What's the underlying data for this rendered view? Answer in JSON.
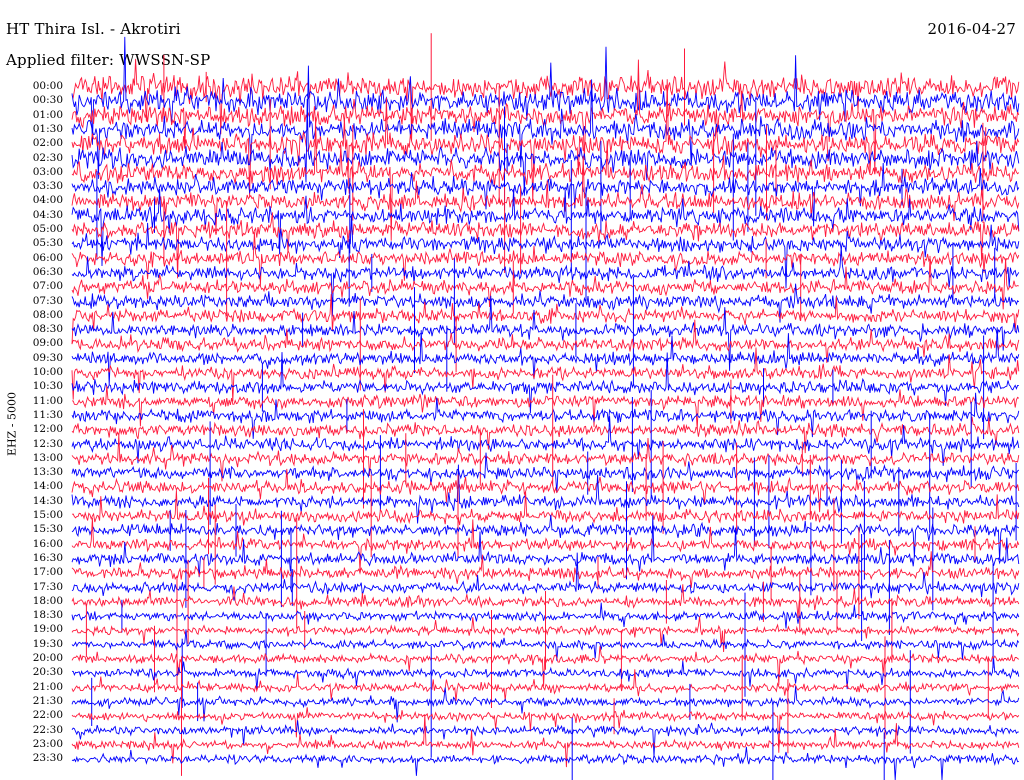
{
  "header": {
    "station": "HT Thira Isl. - Akrotiri",
    "filter": "Applied filter: WWSSN-SP",
    "date": "2016-04-27"
  },
  "channel_label": "EHZ - 5000",
  "colors": {
    "odd_trace": "#0000ff",
    "even_trace": "#ff1a3c",
    "background": "#ffffff"
  },
  "chart_data": {
    "type": "line",
    "title": "HT Thira Isl. - Akrotiri",
    "subtitle": "Applied filter: WWSSN-SP",
    "date": "2016-04-27",
    "ylabel": "EHZ - 5000",
    "trace_minutes": 30,
    "time_labels": [
      "00:00",
      "00:30",
      "01:00",
      "01:30",
      "02:00",
      "02:30",
      "03:00",
      "03:30",
      "04:00",
      "04:30",
      "05:00",
      "05:30",
      "06:00",
      "06:30",
      "07:00",
      "07:30",
      "08:00",
      "08:30",
      "09:00",
      "09:30",
      "10:00",
      "10:30",
      "11:00",
      "11:30",
      "12:00",
      "12:30",
      "13:00",
      "13:30",
      "14:00",
      "14:30",
      "15:00",
      "15:30",
      "16:00",
      "16:30",
      "17:00",
      "17:30",
      "18:00",
      "18:30",
      "19:00",
      "19:30",
      "20:00",
      "20:30",
      "21:00",
      "21:30",
      "22:00",
      "22:30",
      "23:00",
      "23:30"
    ],
    "series_colors": [
      "#ff1a3c",
      "#0000ff"
    ],
    "relative_noise_level": [
      1.4,
      1.3,
      1.2,
      1.2,
      1.2,
      1.2,
      1.1,
      1.0,
      1.0,
      1.0,
      0.95,
      0.9,
      0.85,
      0.8,
      0.8,
      0.8,
      0.75,
      0.75,
      0.75,
      0.75,
      0.75,
      0.75,
      0.75,
      0.75,
      0.75,
      0.75,
      0.75,
      0.75,
      0.75,
      0.7,
      0.7,
      0.7,
      0.7,
      0.7,
      0.7,
      0.65,
      0.6,
      0.55,
      0.5,
      0.5,
      0.5,
      0.5,
      0.5,
      0.5,
      0.5,
      0.5,
      0.5,
      0.5
    ],
    "grid": false,
    "legend": "none"
  }
}
